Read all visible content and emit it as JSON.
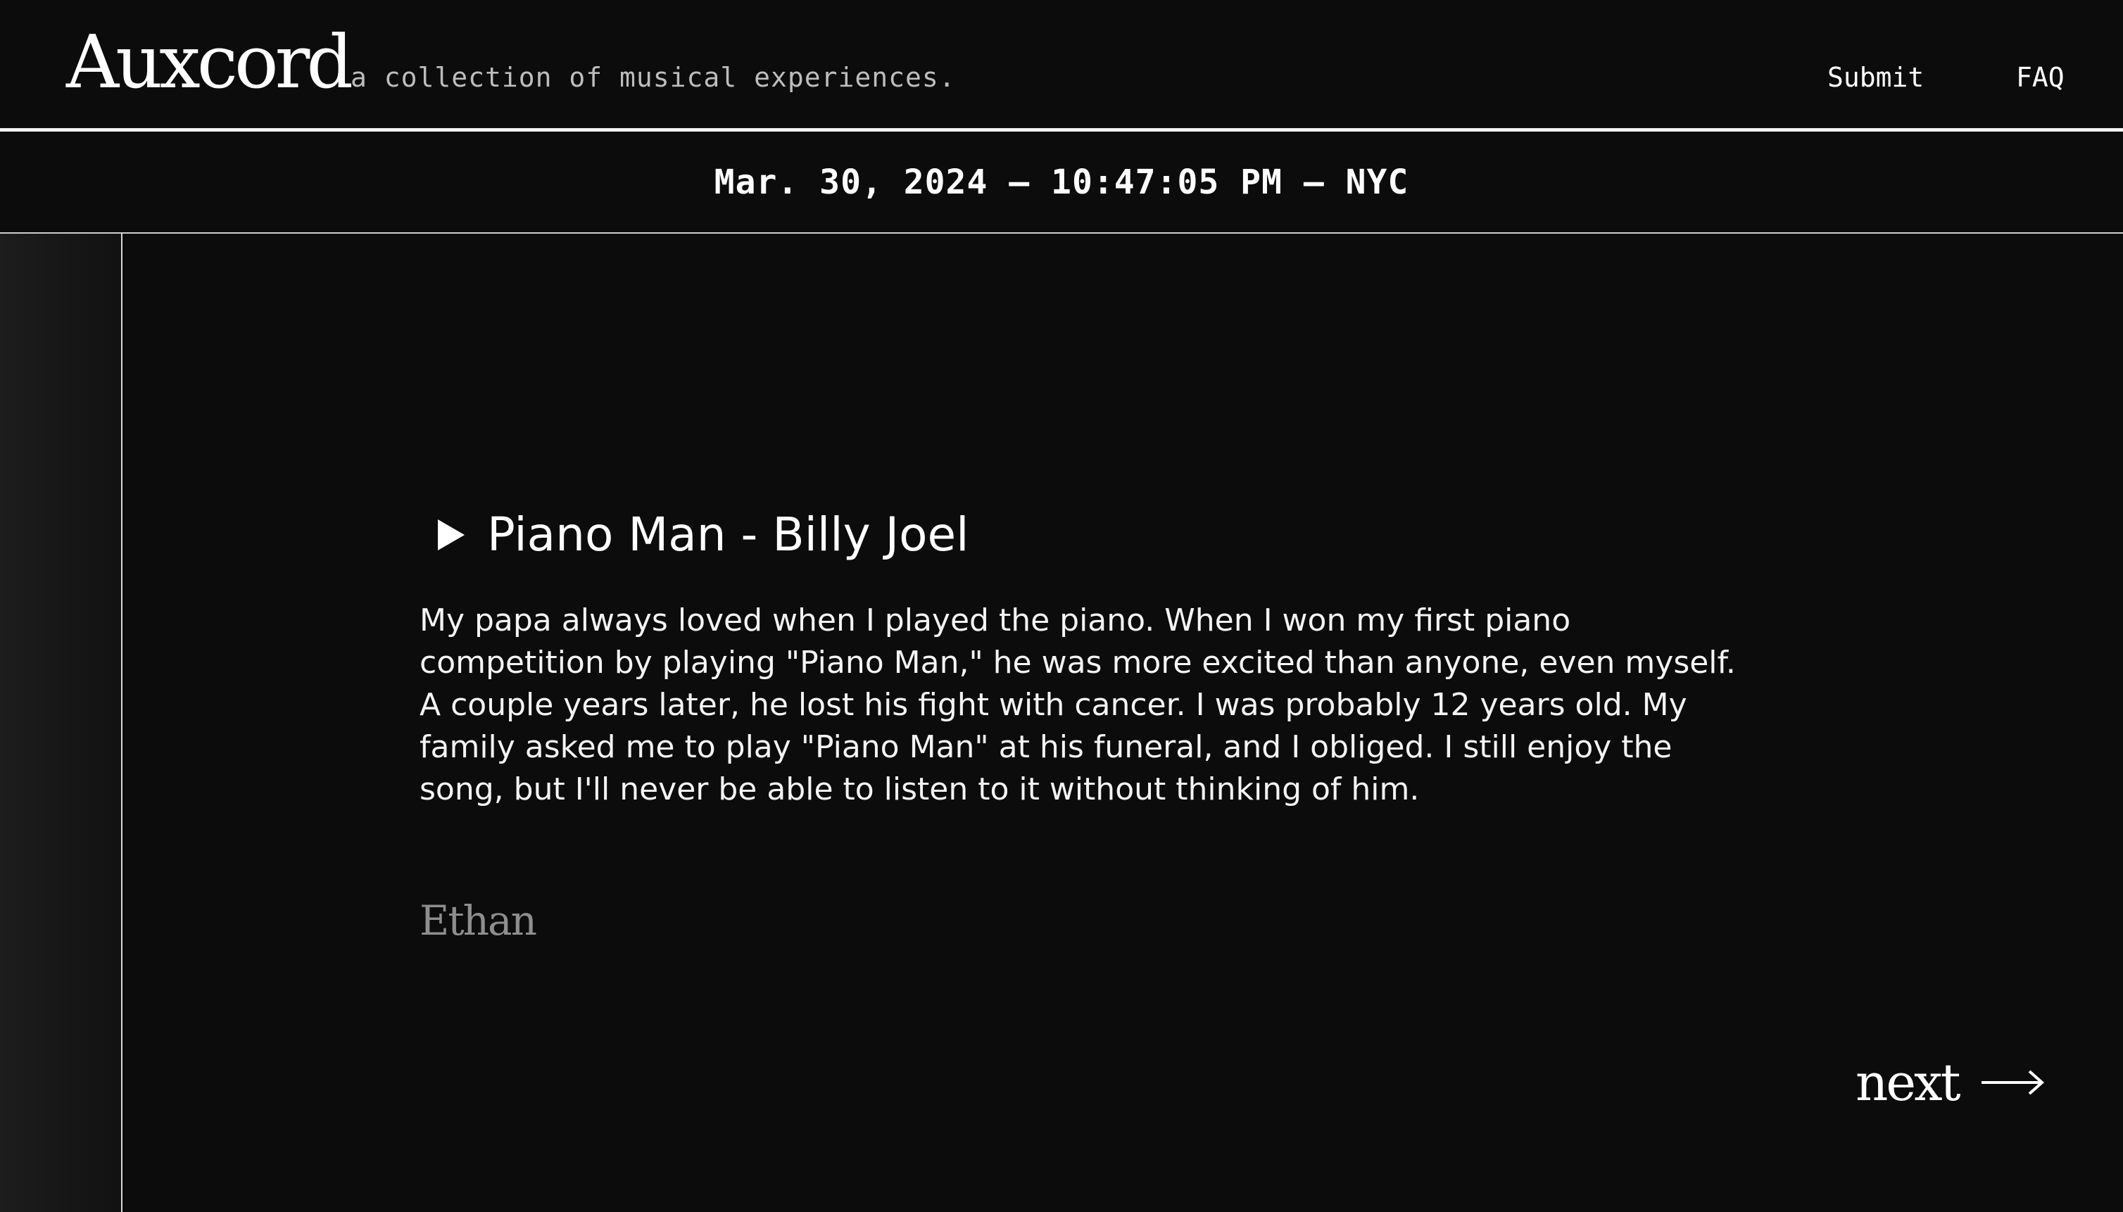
{
  "header": {
    "logo": "Auxcord",
    "tagline": "a collection of musical experiences.",
    "nav": {
      "submit": "Submit",
      "faq": "FAQ"
    }
  },
  "datebar": {
    "text": "Mar. 30, 2024 — 10:47:05 PM — NYC"
  },
  "story": {
    "play_icon": "play-icon",
    "title": "Piano Man - Billy Joel",
    "body": "My papa always loved when I played the piano. When I won my first piano competition by playing \"Piano Man,\" he was more excited than anyone, even myself. A couple years later, he lost his fight with cancer. I was probably 12 years old. My family asked me to play \"Piano Man\" at his funeral, and I obliged. I still enjoy the song, but I'll never be able to listen to it without thinking of him.",
    "author": "Ethan"
  },
  "pagination": {
    "next_label": "next",
    "next_icon": "arrow-right-icon"
  },
  "colors": {
    "background": "#0c0c0c",
    "text": "#ffffff",
    "muted": "#8e8e8e"
  }
}
